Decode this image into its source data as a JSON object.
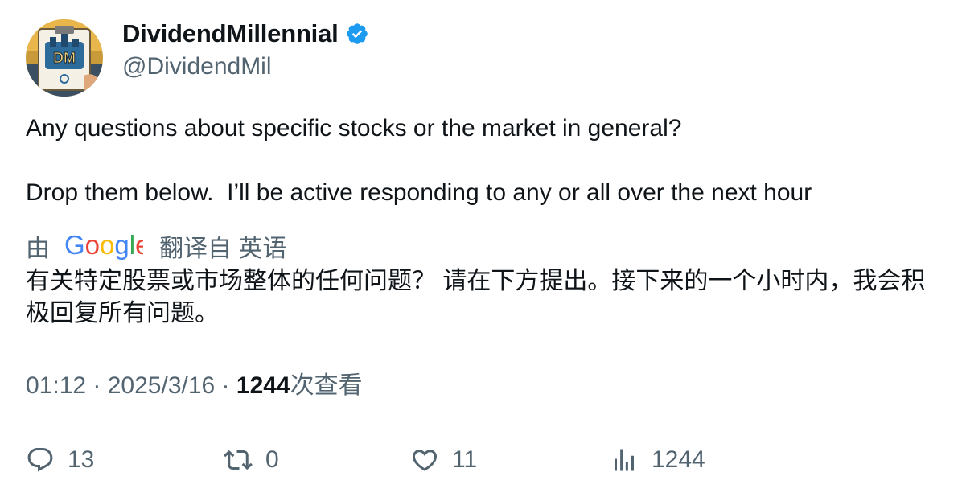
{
  "author": {
    "display_name": "DividendMillennial",
    "handle": "@DividendMil",
    "avatar_logo_text": "DM",
    "verified_color": "#1d9bf0"
  },
  "tweet": {
    "text": "Any questions about specific stocks or the market in general?\n\nDrop them below.  I’ll be active responding to any or all over the next hour"
  },
  "translation": {
    "prefix": "由",
    "provider": "Google",
    "suffix": "翻译自 英语",
    "text": "有关特定股票或市场整体的任何问题？ 请在下方提出。接下来的一个小时内，我会积极回复所有问题。"
  },
  "meta": {
    "time": "01:12",
    "separator1": " · ",
    "date": "2025/3/16",
    "separator2": " · ",
    "views_count": "1244",
    "views_label": "次查看"
  },
  "actions": {
    "replies": "13",
    "retweets": "0",
    "likes": "11",
    "views": "1244"
  },
  "colors": {
    "text_primary": "#0f1419",
    "text_secondary": "#536471",
    "google_blue": "#4285f4",
    "google_red": "#ea4335",
    "google_yellow": "#fbbc05",
    "google_green": "#34a853"
  }
}
